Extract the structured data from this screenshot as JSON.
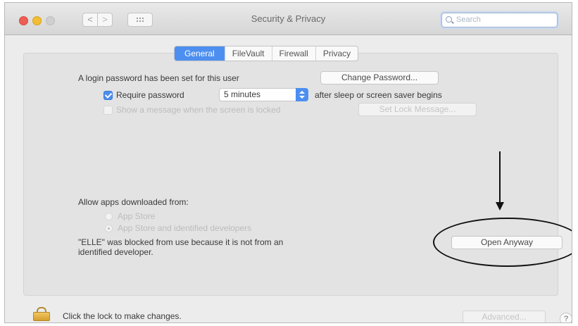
{
  "window": {
    "title": "Security & Privacy",
    "search_placeholder": "Search",
    "back_glyph": "<",
    "forward_glyph": ">"
  },
  "tabs": [
    {
      "label": "General",
      "active": true
    },
    {
      "label": "FileVault",
      "active": false
    },
    {
      "label": "Firewall",
      "active": false
    },
    {
      "label": "Privacy",
      "active": false
    }
  ],
  "general": {
    "login_password_text": "A login password has been set for this user",
    "change_password_button": "Change Password...",
    "require_password_label": "Require password",
    "require_password_checked": true,
    "require_password_delay": "5 minutes",
    "after_sleep_text": "after sleep or screen saver begins",
    "show_message_label": "Show a message when the screen is locked",
    "show_message_checked": false,
    "set_lock_message_button": "Set Lock Message..."
  },
  "allow_apps": {
    "heading": "Allow apps downloaded from:",
    "options": [
      {
        "label": "App Store",
        "selected": false
      },
      {
        "label": "App Store and identified developers",
        "selected": true
      }
    ],
    "blocked_message_line1": "\"ELLE\" was blocked from use because it is not from an",
    "blocked_message_line2": "identified developer.",
    "open_anyway_button": "Open Anyway"
  },
  "footer": {
    "lock_text": "Click the lock to make changes.",
    "advanced_button": "Advanced...",
    "help_glyph": "?"
  },
  "icons": {
    "lock": "lock-icon",
    "help": "help-icon",
    "search": "search-icon",
    "grid": "grid-icon",
    "arrow": "down-arrow-annotation"
  }
}
